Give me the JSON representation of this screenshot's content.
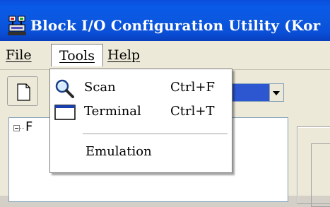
{
  "window": {
    "title": "Block I/O Configuration Utility (Kor",
    "icon": "network-device-icon",
    "title_bar_color": "#0a57df"
  },
  "menubar": {
    "items": [
      {
        "label": "File"
      },
      {
        "label": "Tools"
      },
      {
        "label": "Help"
      }
    ]
  },
  "tools_menu": {
    "items": [
      {
        "icon": "magnifier-icon",
        "label": "Scan",
        "shortcut": "Ctrl+F"
      },
      {
        "icon": "terminal-window-icon",
        "label": "Terminal",
        "shortcut": "Ctrl+T"
      },
      {
        "label": "Emulation"
      }
    ]
  },
  "toolbar": {
    "new_button_icon": "new-document-icon",
    "combo_color": "#2c57d0"
  },
  "tree": {
    "root_label": "F"
  }
}
